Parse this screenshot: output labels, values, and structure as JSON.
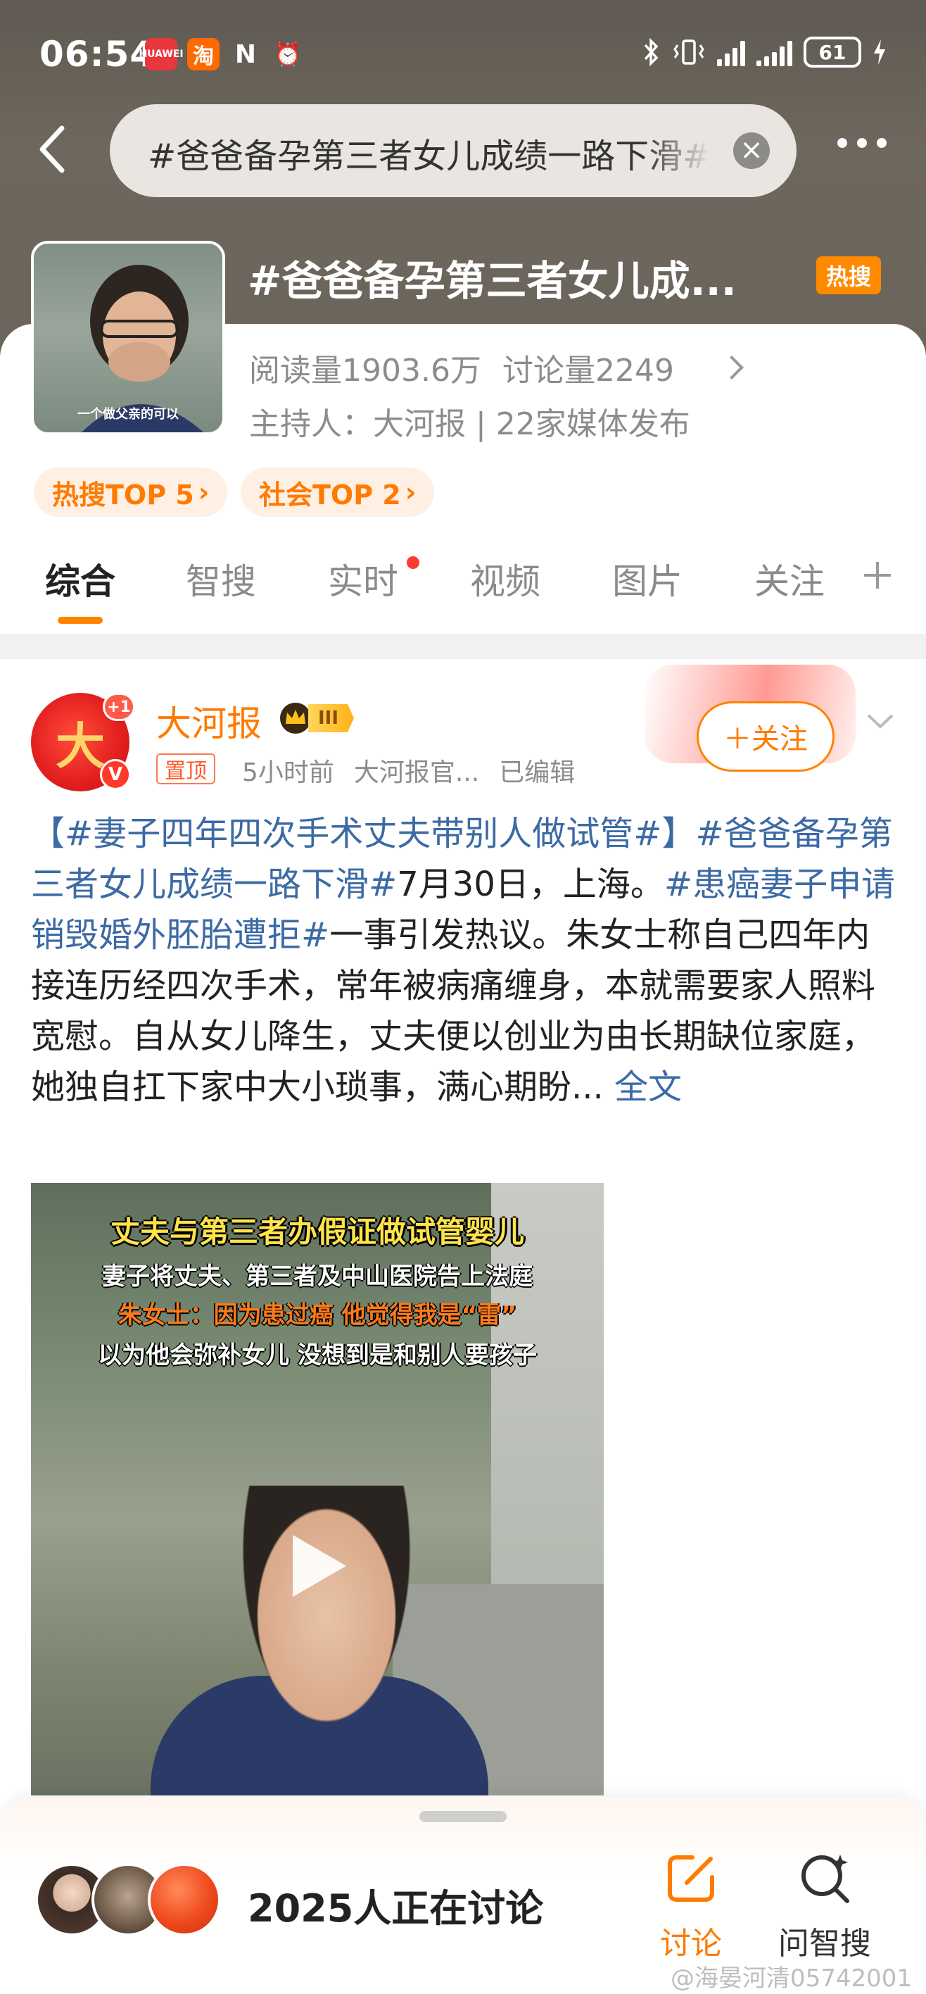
{
  "status_bar": {
    "time": "06:54",
    "apps": [
      {
        "icon": "huawei-app-icon",
        "label": "HUAWEI",
        "color": "#e8383d"
      },
      {
        "icon": "taobao-icon",
        "label": "淘",
        "color": "#ff6a00"
      },
      {
        "icon": "nfc-icon",
        "label": "N"
      },
      {
        "icon": "alarm-icon",
        "label": "⏰"
      }
    ],
    "battery": "61"
  },
  "search": {
    "query": "#爸爸备孕第三者女儿成绩一路下滑#"
  },
  "topic": {
    "title": "#爸爸备孕第三者女儿成...",
    "hot_badge": "热搜",
    "thumb_caption": "一个做父亲的可以",
    "reads": "阅读量1903.6万",
    "discussions": "讨论量2249",
    "host": "主持人：大河报 | 22家媒体发布",
    "chips": [
      "热搜TOP 5",
      "社会TOP 2"
    ]
  },
  "tabs": [
    "综合",
    "智搜",
    "实时",
    "视频",
    "图片",
    "关注"
  ],
  "post": {
    "avatar_text": "大",
    "avatar_plus": "+1",
    "avatar_v": "V",
    "author": "大河报",
    "rank": "III",
    "pin": "置顶",
    "time": "5小时前",
    "source": "大河报官...",
    "edited": "已编辑",
    "follow": "＋关注",
    "text": {
      "tag1": "【#妻子四年四次手术丈夫带别人做试管#】",
      "tag2": "#爸爸备孕第三者女儿成绩一路下滑#",
      "plain1": "7月30日，上海。",
      "tag3": "#患癌妻子申请销毁婚外胚胎遭拒#",
      "plain2": "一事引发热议。朱女士称自己四年内接连历经四次手术，常年被病痛缠身，本就需要家人照料宽慰。自从女儿降生，丈夫便以创业为由长期缺位家庭，她独自扛下家中大小琐事，满心期盼... ",
      "more": "全文"
    },
    "video_captions": [
      "丈夫与第三者办假证做试管婴儿",
      "妻子将丈夫、第三者及中山医院告上法庭",
      "朱女士：因为患过癌 他觉得我是“雷”",
      "以为他会弥补女儿 没想到是和别人要孩子"
    ]
  },
  "bottom": {
    "count_text": "2025人正在讨论",
    "discuss_label": "讨论",
    "ask_label": "问智搜",
    "watermark": "@海晏河清05742001"
  },
  "colors": {
    "accent": "#ff8200",
    "link": "#3c6aa5",
    "hot": "#ff8a00"
  }
}
